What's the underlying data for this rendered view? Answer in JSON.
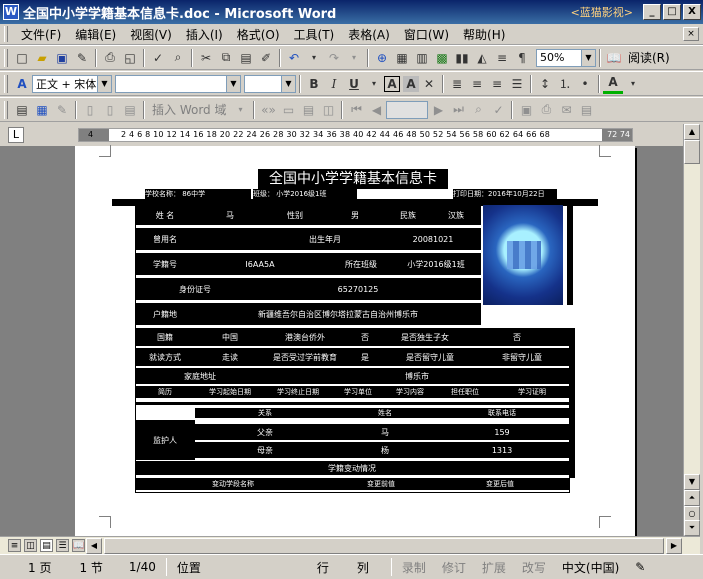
{
  "window": {
    "title": "全国中小学学籍基本信息卡.doc - Microsoft Word",
    "help_hint": "<蓝猫影视>",
    "minimize": "_",
    "maximize": "□",
    "close": "X"
  },
  "menu": {
    "items": [
      "文件(F)",
      "编辑(E)",
      "视图(V)",
      "插入(I)",
      "格式(O)",
      "工具(T)",
      "表格(A)",
      "窗口(W)",
      "帮助(H)"
    ]
  },
  "toolbar_standard": {
    "zoom": "50%",
    "read_button": "阅读(R)"
  },
  "toolbar_format": {
    "style": "正文 + 宋体",
    "font": "",
    "size": ""
  },
  "toolbar_mailmerge": {
    "insert_word_field": "插入 Word 域"
  },
  "ruler": {
    "numbers": "2  4  6  8  10  12  14  16  18  20  22  24  26  28  30  32  34  36  38  40  42  44  46  48  50  52  54  56  58  60  62  64  66  68",
    "left_num": "4",
    "right_num": "72 74"
  },
  "form": {
    "title": "全国中小学学籍基本信息卡",
    "school_name": "学校名称：  86中学",
    "class": "班级：  小学2016级1班",
    "print_date": "打印日期：2016年10月22日",
    "rows": {
      "r1": [
        "姓  名",
        "马",
        "性别",
        "男",
        "民族",
        "汉族"
      ],
      "r2": [
        "曾用名",
        "出生年月",
        "20081021"
      ],
      "r3": [
        "学籍号",
        "I6AA5A",
        "所在班级",
        "小学2016级1班"
      ],
      "r4": [
        "身份证号",
        "65270125"
      ],
      "r5": [
        "户籍地",
        "新疆维吾尔自治区博尔塔拉蒙古自治州博乐市"
      ],
      "r6": [
        "国籍",
        "中国",
        "港澳台侨外",
        "否",
        "是否独生子女",
        "否"
      ],
      "r7": [
        "就读方式",
        "走读",
        "是否受过学前教育",
        "是",
        "是否留守儿童",
        "非留守儿童"
      ],
      "r8": [
        "家庭地址",
        "博乐市"
      ],
      "r9": [
        "简历",
        "学习起始日期",
        "学习终止日期",
        "学习单位",
        "学习内容",
        "担任职位",
        "学习证明"
      ],
      "guardian_label": "监护人",
      "guardian_head": [
        "关系",
        "姓名",
        "联系电话"
      ],
      "guardian1": [
        "父亲",
        "马",
        "159"
      ],
      "guardian2": [
        "母亲",
        "杨",
        "1313"
      ],
      "r_change": "学籍变动情况",
      "r_last": [
        "变动学段名称",
        "变更前值",
        "变更后值"
      ]
    }
  },
  "status": {
    "page": "1 页",
    "section": "1 节",
    "count": "1/40",
    "at": "位置",
    "line": "行",
    "col": "列",
    "rec": "录制",
    "trk": "修订",
    "ext": "扩展",
    "ovr": "改写",
    "lang": "中文(中国)"
  }
}
